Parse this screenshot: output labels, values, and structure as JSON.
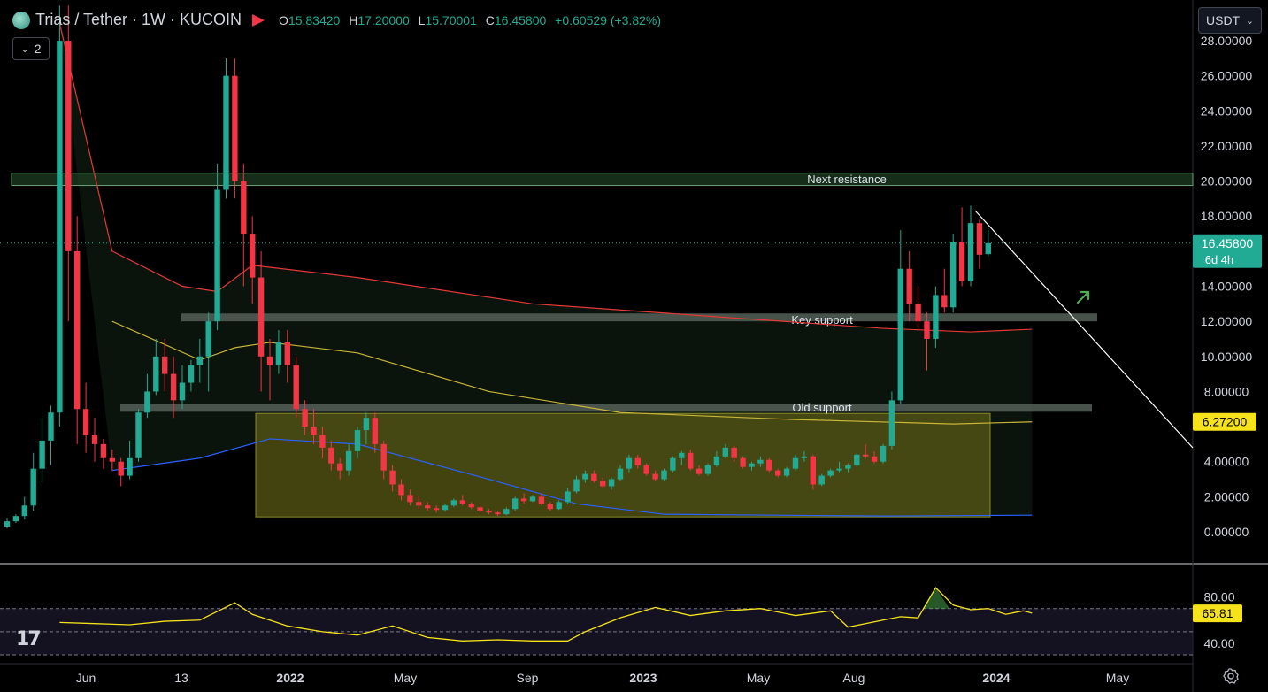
{
  "header": {
    "title": "Trias / Tether · 1W · KUCOIN",
    "open_label": "O",
    "open": "15.83420",
    "high_label": "H",
    "high": "17.20000",
    "low_label": "L",
    "low": "15.70001",
    "close_label": "C",
    "close": "16.45800",
    "change": "+0.60529 (+3.82%)"
  },
  "indicator_toggle": {
    "count": "2"
  },
  "currency_select": {
    "value": "USDT"
  },
  "price_axis": {
    "ticks": [
      "28.00000",
      "26.00000",
      "24.00000",
      "22.00000",
      "20.00000",
      "18.00000",
      "14.00000",
      "12.00000",
      "10.00000",
      "8.00000",
      "4.00000",
      "2.00000",
      "0.00000"
    ],
    "last_price": "16.45800",
    "countdown": "6d 4h",
    "ma_value": "6.27200"
  },
  "rsi_axis": {
    "ticks": [
      "80.00",
      "40.00"
    ],
    "current": "65.81"
  },
  "time_axis": {
    "labels": [
      "Jun",
      "13",
      "2022",
      "May",
      "Sep",
      "2023",
      "May",
      "Aug",
      "2024",
      "May"
    ]
  },
  "annotations": {
    "next_resistance": "Next resistance",
    "key_support": "Key support",
    "old_support": "Old support"
  },
  "colors": {
    "up": "#22ab94",
    "down": "#f23645",
    "ema_red": "#e53935",
    "ma_yellow": "#c9b43a",
    "ma_blue": "#2962ff",
    "rsi": "#f5e21b",
    "zone_green": "#1b3a1f",
    "zone_olive": "#5a5a14",
    "support_band": "#4f5b53",
    "arrow": "#4caf50"
  },
  "chart_data": {
    "type": "candlestick",
    "price_range": [
      0,
      28
    ],
    "candles": [
      [
        0.3,
        0.8,
        0.2,
        0.6
      ],
      [
        0.6,
        1.0,
        0.5,
        0.9
      ],
      [
        0.9,
        2.0,
        0.7,
        1.5
      ],
      [
        1.5,
        4.5,
        1.2,
        3.6
      ],
      [
        3.6,
        6.5,
        2.8,
        5.2
      ],
      [
        5.2,
        7.2,
        3.8,
        6.8
      ],
      [
        6.8,
        30,
        6.0,
        28
      ],
      [
        28,
        30,
        12,
        16
      ],
      [
        16,
        18,
        5,
        7
      ],
      [
        7,
        8.5,
        4.5,
        5.5
      ],
      [
        5.5,
        6.5,
        4.0,
        5.0
      ],
      [
        5.0,
        5.3,
        3.6,
        4.2
      ],
      [
        4.2,
        4.7,
        3.5,
        4.0
      ],
      [
        4.0,
        4.2,
        2.6,
        3.2
      ],
      [
        3.2,
        5.2,
        3.0,
        4.2
      ],
      [
        4.2,
        7.0,
        4.0,
        6.8
      ],
      [
        6.8,
        9.0,
        6.5,
        8.0
      ],
      [
        8.0,
        11,
        7.8,
        10
      ],
      [
        10,
        11,
        8.0,
        9.0
      ],
      [
        9.0,
        10,
        6.5,
        7.5
      ],
      [
        7.5,
        9.5,
        7.0,
        8.5
      ],
      [
        8.5,
        9.8,
        8.0,
        9.5
      ],
      [
        9.5,
        11,
        8.5,
        10
      ],
      [
        10,
        12.5,
        8.0,
        12
      ],
      [
        12,
        21,
        11.5,
        19.5
      ],
      [
        19.5,
        27,
        19,
        26
      ],
      [
        26,
        27,
        19,
        20
      ],
      [
        20,
        21,
        14,
        17
      ],
      [
        17,
        18,
        13,
        14.5
      ],
      [
        14.5,
        16,
        8,
        10
      ],
      [
        10,
        11,
        7.5,
        9.5
      ],
      [
        9.5,
        11.5,
        9,
        10.8
      ],
      [
        10.8,
        11.5,
        8.5,
        9.5
      ],
      [
        9.5,
        10,
        6.5,
        7.0
      ],
      [
        7.0,
        7.5,
        5.5,
        6.0
      ],
      [
        6.0,
        7.0,
        5.0,
        5.5
      ],
      [
        5.5,
        6.0,
        4.2,
        4.8
      ],
      [
        4.8,
        5.2,
        3.5,
        3.9
      ],
      [
        3.9,
        4.2,
        3.0,
        3.5
      ],
      [
        3.5,
        5.0,
        3.2,
        4.6
      ],
      [
        4.6,
        6.0,
        4.2,
        5.8
      ],
      [
        5.8,
        6.8,
        5.0,
        6.5
      ],
      [
        6.5,
        6.8,
        4.5,
        5.0
      ],
      [
        5.0,
        5.2,
        3.0,
        3.5
      ],
      [
        3.5,
        3.8,
        2.3,
        2.7
      ],
      [
        2.7,
        3.0,
        1.8,
        2.1
      ],
      [
        2.1,
        2.4,
        1.5,
        1.7
      ],
      [
        1.7,
        2.0,
        1.3,
        1.5
      ],
      [
        1.5,
        1.7,
        1.2,
        1.35
      ],
      [
        1.35,
        1.5,
        1.1,
        1.25
      ],
      [
        1.25,
        1.6,
        1.15,
        1.5
      ],
      [
        1.5,
        1.9,
        1.4,
        1.8
      ],
      [
        1.8,
        2.1,
        1.5,
        1.6
      ],
      [
        1.6,
        1.7,
        1.3,
        1.4
      ],
      [
        1.4,
        1.5,
        1.1,
        1.2
      ],
      [
        1.2,
        1.3,
        1.0,
        1.1
      ],
      [
        1.1,
        1.2,
        0.9,
        1.0
      ],
      [
        1.0,
        1.4,
        0.95,
        1.3
      ],
      [
        1.3,
        2.0,
        1.2,
        1.9
      ],
      [
        1.9,
        2.2,
        1.6,
        1.75
      ],
      [
        1.75,
        2.1,
        1.7,
        2.0
      ],
      [
        2.0,
        2.2,
        1.5,
        1.6
      ],
      [
        1.6,
        1.7,
        1.2,
        1.3
      ],
      [
        1.3,
        1.8,
        1.25,
        1.7
      ],
      [
        1.7,
        2.5,
        1.6,
        2.3
      ],
      [
        2.3,
        3.2,
        2.2,
        3.0
      ],
      [
        3.0,
        3.5,
        2.8,
        3.3
      ],
      [
        3.3,
        3.5,
        2.8,
        2.9
      ],
      [
        2.9,
        3.1,
        2.5,
        2.6
      ],
      [
        2.6,
        3.1,
        2.4,
        3.0
      ],
      [
        3.0,
        3.8,
        2.9,
        3.6
      ],
      [
        3.6,
        4.4,
        3.4,
        4.2
      ],
      [
        4.2,
        4.4,
        3.6,
        3.8
      ],
      [
        3.8,
        3.9,
        3.2,
        3.3
      ],
      [
        3.3,
        3.5,
        2.9,
        3.0
      ],
      [
        3.0,
        3.6,
        2.9,
        3.5
      ],
      [
        3.5,
        4.3,
        3.4,
        4.2
      ],
      [
        4.2,
        4.6,
        3.8,
        4.5
      ],
      [
        4.5,
        4.7,
        3.5,
        3.6
      ],
      [
        3.6,
        3.8,
        3.2,
        3.3
      ],
      [
        3.3,
        3.9,
        3.2,
        3.8
      ],
      [
        3.8,
        4.6,
        3.7,
        4.3
      ],
      [
        4.3,
        5.0,
        4.2,
        4.8
      ],
      [
        4.8,
        4.9,
        4.0,
        4.2
      ],
      [
        4.2,
        4.3,
        3.6,
        3.7
      ],
      [
        3.7,
        4.0,
        3.5,
        3.9
      ],
      [
        3.9,
        4.3,
        3.7,
        4.1
      ],
      [
        4.1,
        4.2,
        3.4,
        3.5
      ],
      [
        3.5,
        3.6,
        3.1,
        3.2
      ],
      [
        3.2,
        3.7,
        3.1,
        3.6
      ],
      [
        3.6,
        4.4,
        3.5,
        4.2
      ],
      [
        4.2,
        4.6,
        4.0,
        4.3
      ],
      [
        4.3,
        4.4,
        2.4,
        2.7
      ],
      [
        2.7,
        3.3,
        2.6,
        3.2
      ],
      [
        3.2,
        3.6,
        3.1,
        3.5
      ],
      [
        3.5,
        4.0,
        3.4,
        3.6
      ],
      [
        3.6,
        3.9,
        3.4,
        3.8
      ],
      [
        3.8,
        4.5,
        3.7,
        4.4
      ],
      [
        4.4,
        5.0,
        4.2,
        4.3
      ],
      [
        4.3,
        4.6,
        3.9,
        4.0
      ],
      [
        4.0,
        5.0,
        3.9,
        4.9
      ],
      [
        4.9,
        8.0,
        4.7,
        7.5
      ],
      [
        7.5,
        17.2,
        7.3,
        15
      ],
      [
        15,
        16,
        12,
        13
      ],
      [
        13,
        14,
        11.5,
        12
      ],
      [
        12,
        12.5,
        9.2,
        11
      ],
      [
        11,
        14,
        10.5,
        13.5
      ],
      [
        13.5,
        15,
        12.5,
        12.8
      ],
      [
        12.8,
        17,
        12.5,
        16.5
      ],
      [
        16.5,
        18.5,
        14,
        14.3
      ],
      [
        14.3,
        18.6,
        14,
        17.6
      ],
      [
        17.6,
        17.8,
        15.0,
        15.8
      ],
      [
        15.834,
        17.2,
        15.7,
        16.458
      ]
    ],
    "ema_red": [
      [
        6,
        29
      ],
      [
        12,
        16
      ],
      [
        20,
        14
      ],
      [
        24,
        13.7
      ],
      [
        28,
        15.2
      ],
      [
        40,
        14.5
      ],
      [
        60,
        13.0
      ],
      [
        80,
        12.3
      ],
      [
        100,
        11.6
      ],
      [
        110,
        11.4
      ],
      [
        117,
        11.55
      ]
    ],
    "ma_yellow": [
      [
        12,
        12
      ],
      [
        22,
        9.8
      ],
      [
        26,
        10.5
      ],
      [
        30,
        10.8
      ],
      [
        40,
        10.2
      ],
      [
        55,
        8.0
      ],
      [
        70,
        6.8
      ],
      [
        90,
        6.4
      ],
      [
        108,
        6.15
      ],
      [
        117,
        6.27
      ]
    ],
    "ma_blue": [
      [
        12,
        3.5
      ],
      [
        22,
        4.2
      ],
      [
        30,
        5.3
      ],
      [
        40,
        5.0
      ],
      [
        55,
        3.0
      ],
      [
        65,
        1.6
      ],
      [
        75,
        1.0
      ],
      [
        100,
        0.9
      ],
      [
        117,
        0.95
      ]
    ],
    "rsi_range": [
      30,
      95
    ],
    "rsi": [
      [
        6,
        58
      ],
      [
        10,
        57
      ],
      [
        14,
        56
      ],
      [
        18,
        59
      ],
      [
        22,
        60
      ],
      [
        26,
        75
      ],
      [
        28,
        65
      ],
      [
        32,
        55
      ],
      [
        36,
        50
      ],
      [
        40,
        47
      ],
      [
        44,
        55
      ],
      [
        48,
        45
      ],
      [
        52,
        42
      ],
      [
        56,
        43
      ],
      [
        60,
        42
      ],
      [
        64,
        42
      ],
      [
        66,
        50
      ],
      [
        70,
        62
      ],
      [
        74,
        71
      ],
      [
        78,
        64
      ],
      [
        82,
        68
      ],
      [
        86,
        70
      ],
      [
        90,
        64
      ],
      [
        94,
        68
      ],
      [
        96,
        54
      ],
      [
        100,
        60
      ],
      [
        102,
        63
      ],
      [
        104,
        62
      ],
      [
        106,
        88
      ],
      [
        108,
        73
      ],
      [
        110,
        69
      ],
      [
        112,
        70
      ],
      [
        114,
        65
      ],
      [
        116,
        68
      ],
      [
        117,
        66
      ]
    ]
  }
}
